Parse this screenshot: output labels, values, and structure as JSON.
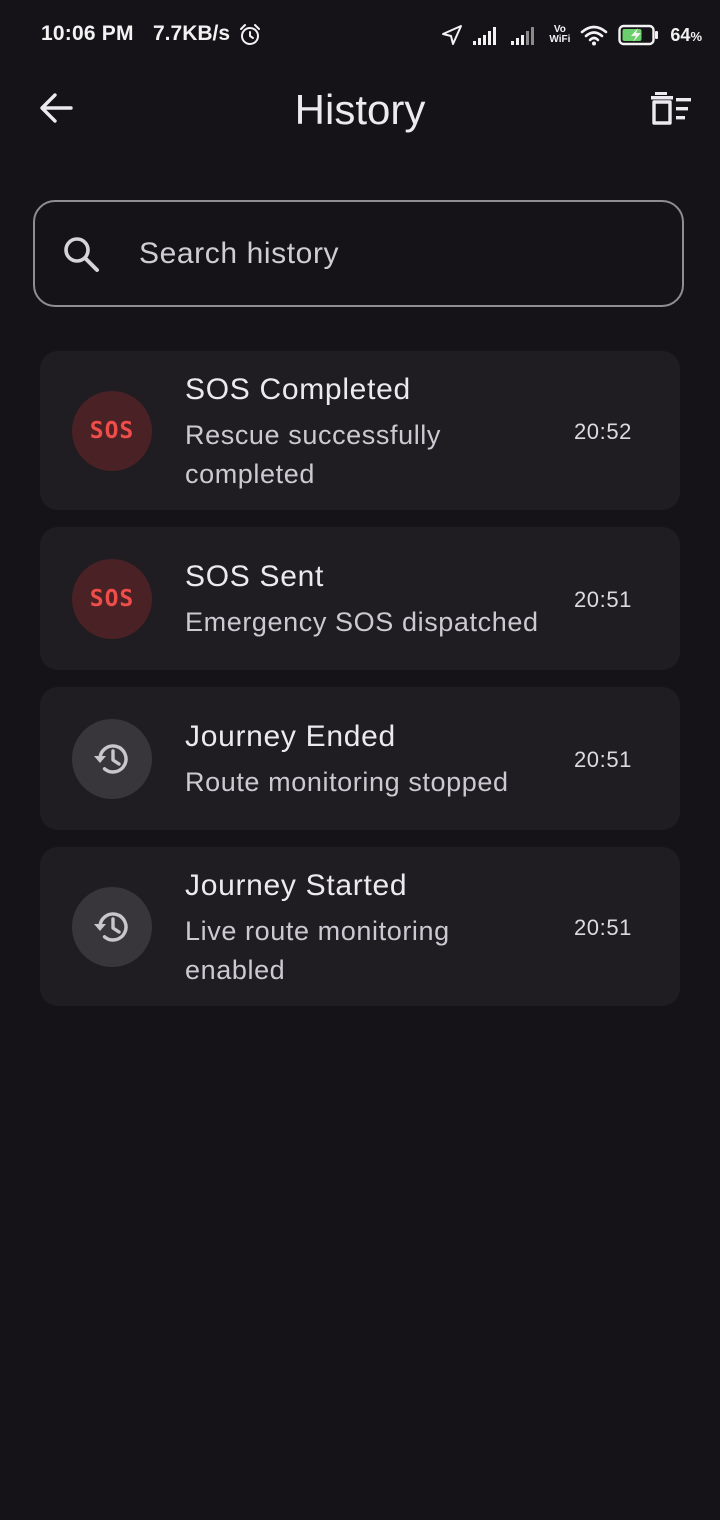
{
  "status_bar": {
    "time": "10:06 PM",
    "network_speed": "7.7KB/s",
    "volte_top": "Vo",
    "volte_bottom": "WiFi",
    "battery_percent": "64",
    "battery_unit": "%",
    "icons": [
      "alarm-icon",
      "location-arrow-icon",
      "signal-icon",
      "signal-icon",
      "wifi-icon",
      "battery-charging-icon"
    ]
  },
  "header": {
    "title": "History",
    "back_icon": "arrow-left-icon",
    "action_icon": "delete-sweep-icon"
  },
  "search": {
    "placeholder": "Search history",
    "value": "",
    "icon": "search-icon"
  },
  "history": {
    "items": [
      {
        "icon": "sos",
        "icon_label": "SOS",
        "title": "SOS Completed",
        "description": "Rescue successfully completed",
        "time": "20:52"
      },
      {
        "icon": "sos",
        "icon_label": "SOS",
        "title": "SOS Sent",
        "description": "Emergency SOS dispatched",
        "time": "20:51"
      },
      {
        "icon": "history",
        "title": "Journey Ended",
        "description": "Route monitoring stopped",
        "time": "20:51"
      },
      {
        "icon": "history",
        "title": "Journey Started",
        "description": "Live route monitoring enabled",
        "time": "20:51"
      }
    ]
  },
  "colors": {
    "background": "#151318",
    "card": "#1f1d22",
    "sos_red": "#ef4d4a",
    "sos_avatar_bg": "#4a2124",
    "history_avatar_bg": "#38363b",
    "battery_bolt": "#6bd06b"
  }
}
